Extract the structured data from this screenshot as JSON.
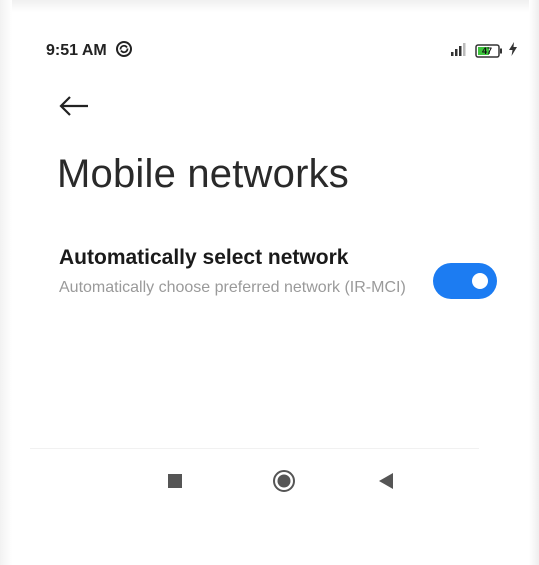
{
  "status_bar": {
    "time": "9:51 AM",
    "battery_level": "47",
    "icons": [
      "sync-status-icon",
      "signal-icon",
      "battery-icon",
      "charging-icon"
    ]
  },
  "header": {
    "back_icon": "arrow-left-icon",
    "title": "Mobile networks"
  },
  "settings": {
    "auto_select": {
      "title": "Automatically select network",
      "subtitle": "Automatically choose preferred network (IR-MCI)",
      "enabled": true
    }
  },
  "nav_bar": {
    "buttons": [
      "recents-square-icon",
      "home-circle-icon",
      "back-triangle-icon"
    ]
  },
  "colors": {
    "accent": "#1c7cf2",
    "title": "#2a2a2a",
    "subtitle": "#9a9a9a",
    "battery": "#3cc43c"
  }
}
